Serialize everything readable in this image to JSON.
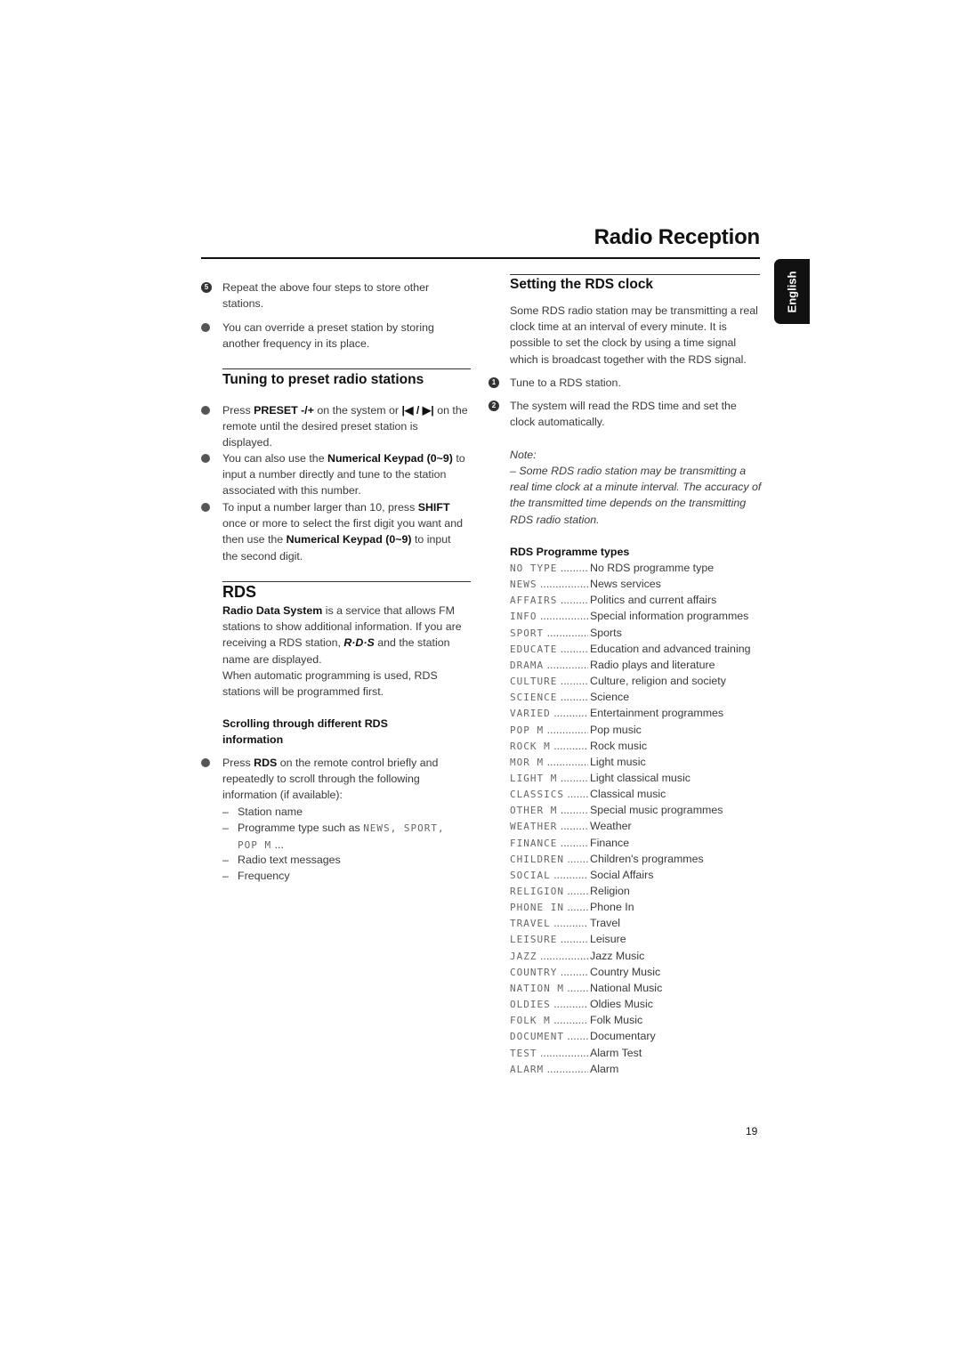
{
  "page": {
    "title": "Radio Reception",
    "language_tab": "English",
    "page_number": "19"
  },
  "left": {
    "step5": {
      "number": "5",
      "text": "Repeat the above four steps to store other stations."
    },
    "override_note": "You can override a preset station by storing another frequency in its place.",
    "tuning_section": {
      "heading": "Tuning to preset radio stations",
      "bullets": [
        {
          "pre": "Press ",
          "bold": "PRESET -/+",
          "mid": " on the system or ",
          "icons": "|◀ / ▶|",
          "post": " on the remote until the desired preset station is displayed."
        },
        {
          "pre": "You can also use the ",
          "bold": "Numerical Keypad (0~9)",
          "post": " to input a number directly and tune to the station associated with this number."
        },
        {
          "pre": "To input a number larger than 10, press ",
          "bold": "SHIFT",
          "mid": " once or more to select the first digit you want and then use the ",
          "bold2": "Numerical Keypad (0~9)",
          "post": " to input the second digit."
        }
      ]
    },
    "rds_section": {
      "heading": "RDS",
      "intro_bold": "Radio Data System",
      "intro_1": " is a service that allows FM stations to show additional information. If you are receiving a RDS station, ",
      "rds_logo": "R·D·S",
      "intro_2": " and the station name are displayed.",
      "intro_3": "When automatic programming is used, RDS stations will be programmed first.",
      "scroll_heading": "Scrolling through different RDS information",
      "scroll_bullet": {
        "pre": "Press ",
        "bold": "RDS",
        "post": " on the remote control briefly and repeatedly to scroll through the following information (if available):"
      },
      "scroll_items": [
        {
          "text": "Station name"
        },
        {
          "text": "Programme type such as ",
          "lcd": "NEWS, SPORT, POP M",
          "suffix": " ..."
        },
        {
          "text": "Radio text messages"
        },
        {
          "text": "Frequency"
        }
      ]
    }
  },
  "right": {
    "clock_section": {
      "heading": "Setting the RDS clock",
      "intro": "Some RDS radio station may be transmitting a real clock time at an interval of every minute. It is possible to set the clock by using a time signal which is broadcast together with the RDS signal.",
      "steps": [
        {
          "number": "1",
          "text": "Tune to a RDS station."
        },
        {
          "number": "2",
          "text": "The system will read the RDS time and set the clock automatically."
        }
      ],
      "note_label": "Note:",
      "note_text": "–  Some RDS radio station may be transmitting a real time clock at a minute interval. The accuracy of the transmitted time depends on the transmitting RDS radio station."
    },
    "programme_types": {
      "heading": "RDS Programme types",
      "items": [
        {
          "code": "NO TYPE",
          "desc": "No RDS programme type"
        },
        {
          "code": "NEWS",
          "desc": "News services"
        },
        {
          "code": "AFFAIRS",
          "desc": "Politics and current affairs"
        },
        {
          "code": "INFO",
          "desc": "Special information programmes"
        },
        {
          "code": "SPORT",
          "desc": "Sports"
        },
        {
          "code": "EDUCATE",
          "desc": "Education and advanced training"
        },
        {
          "code": "DRAMA",
          "desc": "Radio plays and literature"
        },
        {
          "code": "CULTURE",
          "desc": "Culture, religion and society"
        },
        {
          "code": "SCIENCE",
          "desc": "Science"
        },
        {
          "code": "VARIED",
          "desc": "Entertainment programmes"
        },
        {
          "code": "POP M",
          "desc": "Pop music"
        },
        {
          "code": "ROCK M",
          "desc": "Rock music"
        },
        {
          "code": "MOR M",
          "desc": "Light music"
        },
        {
          "code": "LIGHT M",
          "desc": "Light classical music"
        },
        {
          "code": "CLASSICS",
          "desc": "Classical music"
        },
        {
          "code": "OTHER M",
          "desc": "Special music programmes"
        },
        {
          "code": "WEATHER",
          "desc": "Weather"
        },
        {
          "code": "FINANCE",
          "desc": "Finance"
        },
        {
          "code": "CHILDREN",
          "desc": "Children's programmes"
        },
        {
          "code": "SOCIAL",
          "desc": "Social Affairs"
        },
        {
          "code": "RELIGION",
          "desc": "Religion"
        },
        {
          "code": "PHONE IN",
          "desc": "Phone In"
        },
        {
          "code": "TRAVEL",
          "desc": "Travel"
        },
        {
          "code": "LEISURE",
          "desc": "Leisure"
        },
        {
          "code": "JAZZ",
          "desc": "Jazz Music"
        },
        {
          "code": "COUNTRY",
          "desc": "Country Music"
        },
        {
          "code": "NATION M",
          "desc": "National Music"
        },
        {
          "code": "OLDIES",
          "desc": "Oldies Music"
        },
        {
          "code": "FOLK M",
          "desc": "Folk Music"
        },
        {
          "code": "DOCUMENT",
          "desc": "Documentary"
        },
        {
          "code": "TEST",
          "desc": "Alarm Test"
        },
        {
          "code": "ALARM",
          "desc": "Alarm"
        }
      ]
    }
  }
}
